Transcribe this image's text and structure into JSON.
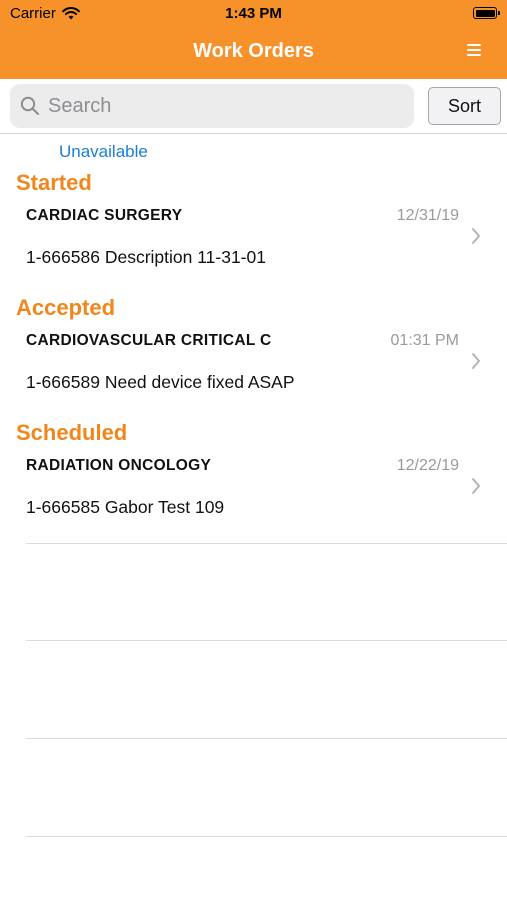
{
  "status_bar": {
    "carrier": "Carrier",
    "time": "1:43 PM"
  },
  "header": {
    "title": "Work Orders",
    "menu_icon": "hamburger-menu-icon",
    "background": "#f7922a"
  },
  "search": {
    "placeholder": "Search",
    "value": "",
    "sort_label": "Sort"
  },
  "filter_link": "Unavailable",
  "sections": [
    {
      "title": "Started",
      "order": {
        "department": "CARDIAC SURGERY",
        "date": "12/31/19",
        "description": "1-666586 Description 11-31-01"
      }
    },
    {
      "title": "Accepted",
      "order": {
        "department": "CARDIOVASCULAR CRITICAL C",
        "date": "01:31 PM",
        "description": "1-666589 Need device fixed ASAP"
      }
    },
    {
      "title": "Scheduled",
      "order": {
        "department": "RADIATION ONCOLOGY",
        "date": "12/22/19",
        "description": "1-666585 Gabor Test 109"
      }
    }
  ],
  "colors": {
    "accent": "#f0871c",
    "link": "#1a7ed6"
  }
}
